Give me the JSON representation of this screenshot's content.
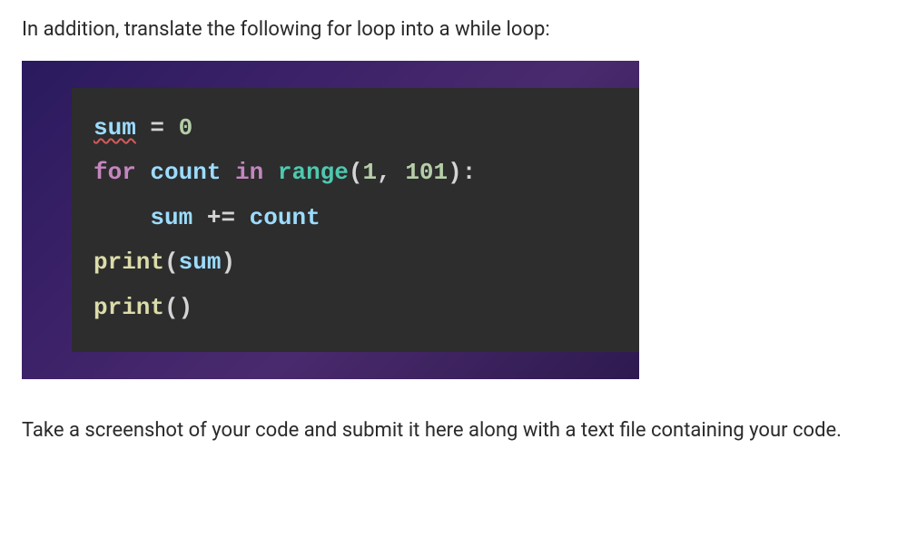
{
  "instruction_top": "In addition, translate the following for loop into a while loop:",
  "code": {
    "line1": {
      "sum": "sum",
      "assign": " = ",
      "zero": "0"
    },
    "line2": {
      "for": "for",
      "sp1": " ",
      "count": "count",
      "sp2": " ",
      "in": "in",
      "sp3": " ",
      "range": "range",
      "lp": "(",
      "one": "1",
      "comma": ", ",
      "hundred": "101",
      "rp": ")",
      "colon": ":"
    },
    "line3": {
      "indent": "    ",
      "sumv": "sum",
      "sp1": " ",
      "pluseq": "+=",
      "sp2": " ",
      "countv": "count"
    },
    "line4": {
      "print": "print",
      "lp": "(",
      "sumv": "sum",
      "rp": ")"
    },
    "line5": {
      "print": "print",
      "lp": "(",
      "rp": ")"
    }
  },
  "instruction_bottom": "Take a screenshot of your code and submit it here along with a text file containing your code."
}
